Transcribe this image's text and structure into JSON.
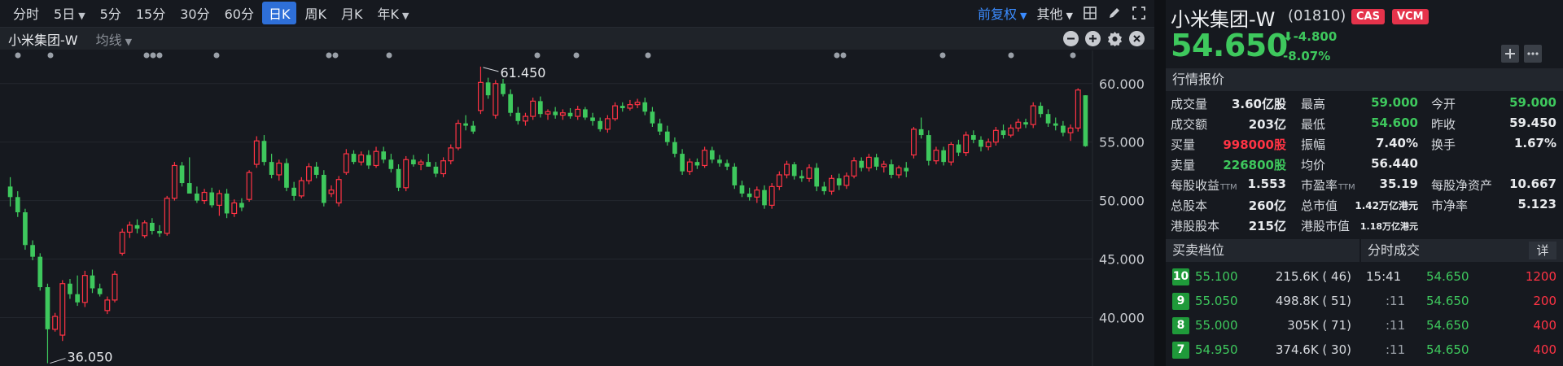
{
  "toolbar": {
    "periods": [
      {
        "label": "分时",
        "caret": false,
        "active": false
      },
      {
        "label": "5日",
        "caret": true,
        "active": false
      },
      {
        "label": "5分",
        "caret": false,
        "active": false
      },
      {
        "label": "15分",
        "caret": false,
        "active": false
      },
      {
        "label": "30分",
        "caret": false,
        "active": false
      },
      {
        "label": "60分",
        "caret": false,
        "active": false
      },
      {
        "label": "日K",
        "caret": false,
        "active": true
      },
      {
        "label": "周K",
        "caret": false,
        "active": false
      },
      {
        "label": "月K",
        "caret": false,
        "active": false
      },
      {
        "label": "年K",
        "caret": true,
        "active": false
      }
    ],
    "adjust_label": "前复权",
    "other_label": "其他",
    "tools": [
      "layout-grid-icon",
      "pen-icon",
      "fullscreen-icon"
    ]
  },
  "subbar": {
    "stock_label": "小米集团-W",
    "ma_label": "均线",
    "icons": [
      "zoom-out-icon",
      "zoom-in-icon",
      "settings-icon",
      "close-icon"
    ]
  },
  "chart_data": {
    "type": "candlestick",
    "y_axis_labels": [
      "60.000",
      "55.000",
      "50.000",
      "45.000",
      "40.000"
    ],
    "ylim": [
      36.0,
      62.0
    ],
    "high_annotation": "61.450",
    "low_annotation": "36.050",
    "up_color": "#ff3344",
    "down_color": "#3ec85d",
    "candles": [
      [
        51.2,
        52.0,
        49.5,
        50.3
      ],
      [
        50.3,
        50.8,
        48.6,
        49.0
      ],
      [
        49.0,
        49.3,
        45.8,
        46.2
      ],
      [
        46.2,
        46.6,
        44.9,
        45.2
      ],
      [
        45.2,
        45.5,
        42.3,
        42.6
      ],
      [
        42.6,
        42.9,
        36.1,
        39.0
      ],
      [
        39.0,
        40.4,
        38.8,
        40.1
      ],
      [
        38.5,
        43.2,
        38.0,
        42.9
      ],
      [
        42.9,
        43.3,
        41.6,
        42.0
      ],
      [
        42.0,
        43.6,
        41.0,
        41.3
      ],
      [
        41.3,
        44.0,
        40.9,
        43.6
      ],
      [
        43.6,
        44.1,
        42.1,
        42.5
      ],
      [
        42.5,
        42.9,
        41.8,
        42.0
      ],
      [
        40.6,
        41.8,
        40.3,
        41.5
      ],
      [
        41.5,
        44.0,
        41.3,
        43.7
      ],
      [
        45.5,
        47.6,
        45.3,
        47.3
      ],
      [
        47.3,
        48.2,
        46.8,
        47.9
      ],
      [
        47.9,
        48.4,
        47.2,
        47.6
      ],
      [
        47.0,
        48.3,
        46.8,
        48.1
      ],
      [
        48.1,
        48.5,
        47.1,
        47.4
      ],
      [
        47.4,
        47.9,
        46.9,
        47.2
      ],
      [
        47.2,
        50.4,
        47.0,
        50.2
      ],
      [
        50.2,
        53.3,
        50.0,
        53.0
      ],
      [
        53.0,
        53.3,
        51.2,
        51.5
      ],
      [
        51.5,
        53.7,
        51.1,
        50.6
      ],
      [
        50.6,
        51.2,
        49.8,
        50.0
      ],
      [
        50.0,
        51.0,
        49.7,
        50.7
      ],
      [
        50.7,
        51.1,
        49.4,
        49.6
      ],
      [
        49.6,
        50.9,
        48.7,
        50.6
      ],
      [
        50.6,
        51.0,
        48.5,
        48.9
      ],
      [
        48.9,
        50.1,
        48.6,
        49.8
      ],
      [
        49.8,
        50.2,
        49.1,
        49.4
      ],
      [
        50.1,
        52.6,
        49.9,
        52.4
      ],
      [
        53.1,
        55.5,
        52.8,
        55.1
      ],
      [
        55.1,
        55.6,
        53.0,
        53.3
      ],
      [
        53.3,
        54.0,
        51.9,
        52.2
      ],
      [
        52.2,
        53.5,
        51.7,
        53.2
      ],
      [
        53.2,
        53.6,
        50.8,
        51.1
      ],
      [
        51.1,
        51.6,
        50.0,
        50.4
      ],
      [
        50.4,
        52.0,
        50.2,
        51.7
      ],
      [
        51.7,
        53.2,
        51.4,
        52.9
      ],
      [
        52.9,
        53.3,
        51.9,
        52.2
      ],
      [
        52.2,
        52.6,
        49.5,
        49.8
      ],
      [
        50.6,
        51.3,
        50.3,
        50.9
      ],
      [
        49.8,
        52.1,
        49.5,
        51.8
      ],
      [
        52.4,
        54.4,
        52.2,
        54.0
      ],
      [
        54.0,
        54.3,
        53.1,
        53.3
      ],
      [
        53.3,
        54.2,
        53.0,
        53.9
      ],
      [
        53.9,
        54.3,
        52.7,
        53.0
      ],
      [
        53.0,
        54.6,
        52.8,
        54.2
      ],
      [
        54.2,
        54.6,
        53.2,
        53.5
      ],
      [
        53.5,
        54.0,
        52.4,
        52.7
      ],
      [
        52.7,
        53.1,
        50.8,
        51.1
      ],
      [
        51.1,
        53.8,
        50.8,
        53.5
      ],
      [
        53.5,
        53.9,
        52.9,
        53.1
      ],
      [
        53.1,
        53.5,
        52.6,
        53.3
      ],
      [
        53.3,
        54.0,
        52.9,
        52.9
      ],
      [
        52.9,
        53.3,
        52.0,
        52.3
      ],
      [
        52.3,
        53.7,
        52.0,
        53.4
      ],
      [
        53.4,
        54.8,
        53.1,
        54.5
      ],
      [
        54.5,
        56.9,
        54.3,
        56.6
      ],
      [
        56.6,
        57.3,
        56.0,
        56.4
      ],
      [
        56.4,
        56.8,
        55.7,
        55.9
      ],
      [
        57.7,
        61.45,
        57.4,
        60.1
      ],
      [
        60.1,
        60.5,
        58.7,
        59.0
      ],
      [
        57.3,
        60.3,
        57.0,
        60.0
      ],
      [
        60.0,
        60.4,
        58.9,
        59.1
      ],
      [
        59.1,
        59.5,
        57.2,
        57.5
      ],
      [
        57.5,
        58.0,
        56.5,
        56.8
      ],
      [
        56.8,
        57.5,
        56.4,
        57.2
      ],
      [
        57.2,
        58.8,
        56.9,
        58.5
      ],
      [
        58.5,
        58.9,
        57.1,
        57.4
      ],
      [
        57.4,
        57.8,
        56.9,
        57.6
      ],
      [
        57.6,
        58.0,
        57.0,
        57.3
      ],
      [
        57.3,
        57.8,
        56.9,
        57.5
      ],
      [
        57.5,
        57.9,
        57.0,
        57.2
      ],
      [
        57.2,
        58.1,
        56.9,
        57.8
      ],
      [
        57.8,
        58.0,
        56.9,
        57.1
      ],
      [
        57.1,
        57.5,
        56.4,
        56.8
      ],
      [
        56.8,
        57.1,
        55.9,
        56.1
      ],
      [
        56.1,
        57.3,
        55.8,
        57.0
      ],
      [
        57.0,
        58.4,
        56.8,
        58.1
      ],
      [
        58.1,
        58.4,
        57.6,
        57.9
      ],
      [
        57.9,
        58.6,
        57.7,
        58.2
      ],
      [
        58.2,
        58.7,
        57.9,
        58.4
      ],
      [
        58.4,
        58.8,
        57.3,
        57.6
      ],
      [
        57.6,
        58.0,
        56.3,
        56.6
      ],
      [
        56.6,
        57.0,
        55.6,
        55.9
      ],
      [
        55.9,
        56.4,
        54.7,
        55.0
      ],
      [
        55.0,
        55.4,
        53.7,
        54.0
      ],
      [
        54.0,
        54.4,
        52.2,
        52.5
      ],
      [
        52.5,
        53.6,
        52.2,
        53.3
      ],
      [
        53.3,
        53.6,
        52.7,
        53.0
      ],
      [
        53.0,
        54.6,
        52.8,
        54.3
      ],
      [
        54.3,
        54.6,
        53.2,
        53.5
      ],
      [
        53.5,
        53.9,
        52.9,
        53.2
      ],
      [
        53.2,
        53.5,
        52.6,
        52.9
      ],
      [
        52.9,
        53.2,
        51.0,
        51.3
      ],
      [
        51.3,
        51.7,
        50.3,
        50.6
      ],
      [
        50.6,
        51.1,
        50.0,
        50.3
      ],
      [
        50.3,
        51.2,
        49.8,
        50.9
      ],
      [
        50.9,
        51.3,
        49.3,
        49.6
      ],
      [
        49.6,
        51.5,
        49.3,
        51.2
      ],
      [
        51.2,
        52.5,
        50.9,
        52.2
      ],
      [
        52.2,
        53.4,
        51.9,
        53.1
      ],
      [
        53.1,
        53.3,
        51.8,
        52.1
      ],
      [
        52.1,
        52.6,
        51.6,
        51.9
      ],
      [
        51.9,
        53.1,
        51.6,
        52.8
      ],
      [
        52.8,
        53.2,
        50.8,
        51.2
      ],
      [
        51.2,
        51.6,
        50.5,
        50.8
      ],
      [
        50.8,
        52.2,
        50.5,
        51.9
      ],
      [
        51.9,
        52.3,
        50.9,
        51.3
      ],
      [
        51.3,
        52.4,
        51.0,
        52.1
      ],
      [
        52.1,
        53.7,
        51.9,
        53.4
      ],
      [
        53.4,
        53.7,
        52.5,
        52.8
      ],
      [
        52.8,
        54.0,
        52.5,
        53.7
      ],
      [
        53.7,
        54.0,
        52.6,
        52.9
      ],
      [
        52.9,
        53.4,
        52.4,
        53.1
      ],
      [
        53.1,
        53.5,
        51.9,
        52.2
      ],
      [
        52.2,
        53.0,
        51.9,
        52.8
      ],
      [
        52.8,
        53.3,
        52.0,
        52.5
      ],
      [
        53.9,
        56.3,
        53.6,
        56.1
      ],
      [
        56.1,
        57.1,
        55.3,
        55.6
      ],
      [
        55.6,
        56.0,
        53.0,
        53.4
      ],
      [
        53.4,
        54.6,
        53.1,
        54.3
      ],
      [
        54.3,
        54.6,
        53.0,
        53.3
      ],
      [
        53.3,
        55.0,
        53.0,
        54.8
      ],
      [
        54.8,
        55.2,
        53.8,
        54.1
      ],
      [
        54.1,
        55.9,
        53.8,
        55.6
      ],
      [
        55.6,
        56.0,
        54.9,
        55.2
      ],
      [
        55.2,
        55.5,
        54.2,
        54.6
      ],
      [
        54.6,
        55.3,
        54.3,
        55.0
      ],
      [
        55.0,
        56.3,
        54.7,
        56.0
      ],
      [
        56.0,
        56.5,
        55.3,
        55.6
      ],
      [
        55.6,
        56.5,
        55.4,
        56.2
      ],
      [
        56.2,
        57.0,
        55.9,
        56.7
      ],
      [
        56.7,
        57.0,
        56.2,
        56.5
      ],
      [
        56.5,
        58.4,
        56.2,
        58.1
      ],
      [
        58.1,
        58.4,
        57.1,
        57.4
      ],
      [
        57.4,
        57.8,
        56.3,
        56.6
      ],
      [
        56.6,
        57.1,
        56.0,
        56.4
      ],
      [
        56.4,
        56.8,
        55.5,
        55.8
      ],
      [
        55.8,
        56.5,
        55.1,
        56.2
      ],
      [
        56.2,
        59.6,
        55.9,
        59.45
      ],
      [
        59.0,
        59.0,
        54.6,
        54.65
      ]
    ]
  },
  "quote": {
    "name": "小米集团-W",
    "code": "(01810)",
    "tags": [
      "CAS",
      "VCM"
    ],
    "price": "54.650",
    "change": "-4.800",
    "change_pct": "-8.07%",
    "section_title": "行情报价",
    "stats": {
      "volume_label": "成交量",
      "volume": "3.60亿股",
      "high_label": "最高",
      "high": "59.000",
      "open_label": "今开",
      "open": "59.000",
      "turnover_label": "成交额",
      "turnover": "203亿",
      "low_label": "最低",
      "low": "54.600",
      "prev_close_label": "昨收",
      "prev_close": "59.450",
      "buy_vol_label": "买量",
      "buy_vol": "998000股",
      "amplitude_label": "振幅",
      "amplitude": "7.40%",
      "turnover_rate_label": "换手",
      "turnover_rate": "1.67%",
      "sell_vol_label": "卖量",
      "sell_vol": "226800股",
      "avg_label": "均价",
      "avg": "56.440",
      "eps_label": "每股收益",
      "eps": "1.553",
      "pe_label": "市盈率",
      "pe": "35.19",
      "ttm": "TTM",
      "nav_label": "每股净资产",
      "nav": "10.667",
      "total_shares_label": "总股本",
      "total_shares": "260亿",
      "mkt_cap_label": "总市值",
      "mkt_cap": "1.42万亿港元",
      "pb_label": "市净率",
      "pb": "5.123",
      "hk_shares_label": "港股股本",
      "hk_shares": "215亿",
      "hk_cap_label": "港股市值",
      "hk_cap": "1.18万亿港元"
    }
  },
  "orderbook": {
    "title": "买卖档位",
    "rows": [
      {
        "level": "10",
        "price": "55.100",
        "vol": "215.6K ( 46)"
      },
      {
        "level": "9",
        "price": "55.050",
        "vol": "498.8K ( 51)"
      },
      {
        "level": "8",
        "price": "55.000",
        "vol": "305K ( 71)"
      },
      {
        "level": "7",
        "price": "54.950",
        "vol": "374.6K ( 30)"
      }
    ]
  },
  "timesales": {
    "title": "分时成交",
    "detail_label": "详",
    "rows": [
      {
        "time": "15:41",
        "minor": false,
        "price": "54.650",
        "vol": "1200"
      },
      {
        "time": ":11",
        "minor": true,
        "price": "54.650",
        "vol": "200"
      },
      {
        "time": ":11",
        "minor": true,
        "price": "54.650",
        "vol": "400"
      },
      {
        "time": ":11",
        "minor": true,
        "price": "54.650",
        "vol": "400"
      }
    ]
  }
}
